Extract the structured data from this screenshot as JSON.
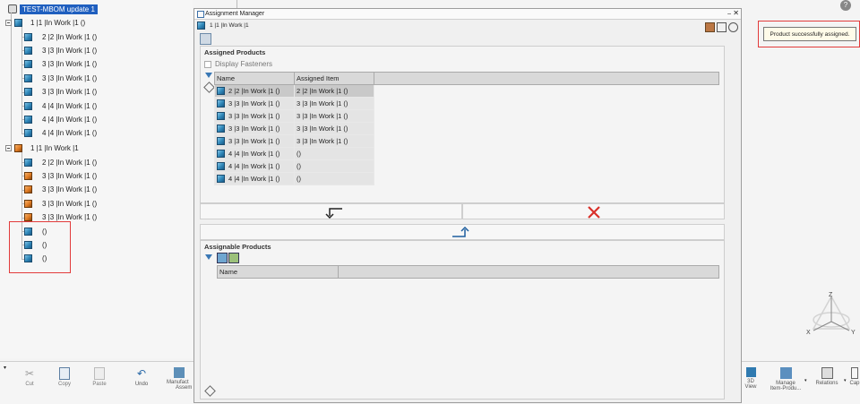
{
  "tree": {
    "root_label": "TEST-MBOM update 1",
    "group1_label": "1 |1 |In Work |1 ()",
    "group1_items": [
      "2 |2 |In Work |1 ()",
      "3 |3 |In Work |1 ()",
      "3 |3 |In Work |1 ()",
      "3 |3 |In Work |1 ()",
      "3 |3 |In Work |1 ()",
      "4 |4 |In Work |1 ()",
      "4 |4 |In Work |1 ()",
      "4 |4 |In Work |1 ()"
    ],
    "group2_label": "1 |1 |In Work |1",
    "group2_items": [
      "2 |2 |In Work |1 ()",
      "3 |3 |In Work |1 ()",
      "3 |3 |In Work |1 ()",
      "3 |3 |In Work |1 ()",
      "3 |3 |In Work |1 ()"
    ],
    "unassigned_items": [
      "()",
      "()",
      "()"
    ]
  },
  "dialog": {
    "title": "Assignment Manager",
    "header_item": "1 |1 |In Work |1",
    "assigned_section_title": "Assigned Products",
    "display_fasteners_label": "Display Fasteners",
    "col_name": "Name",
    "col_assigned_item": "Assigned Item",
    "assigned_rows": [
      {
        "name": "2 |2 |In Work |1 ()",
        "item": "2 |2 |In Work |1 ()"
      },
      {
        "name": "3 |3 |In Work |1 ()",
        "item": "3 |3 |In Work |1 ()"
      },
      {
        "name": "3 |3 |In Work |1 ()",
        "item": "3 |3 |In Work |1 ()"
      },
      {
        "name": "3 |3 |In Work |1 ()",
        "item": "3 |3 |In Work |1 ()"
      },
      {
        "name": "3 |3 |In Work |1 ()",
        "item": "3 |3 |In Work |1 ()"
      },
      {
        "name": "4 |4 |In Work |1 ()",
        "item": "()"
      },
      {
        "name": "4 |4 |In Work |1 ()",
        "item": "()"
      },
      {
        "name": "4 |4 |In Work |1 ()",
        "item": "()"
      }
    ],
    "assignable_section_title": "Assignable Products",
    "assignable_col_name": "Name"
  },
  "toolbar": {
    "cut": "Cut",
    "copy": "Copy",
    "paste": "Paste",
    "undo": "Undo",
    "manufact": "Manufact",
    "assem": "Assem"
  },
  "right_toolbar": {
    "view_3d_a": "3D",
    "view_3d_b": "View",
    "manage_a": "Manage",
    "manage_b": "Item-Produ...",
    "relations": "Relations",
    "cap": "Cap"
  },
  "toast": {
    "message": "Product successfully assigned."
  },
  "compass": {
    "z": "Z",
    "x": "X",
    "y": "Y"
  },
  "colors": {
    "selection_blue": "#1f5fbf",
    "highlight_red": "#e23b3b",
    "cancel_red": "#d9302a",
    "arrow_blue": "#1f5f9f"
  }
}
